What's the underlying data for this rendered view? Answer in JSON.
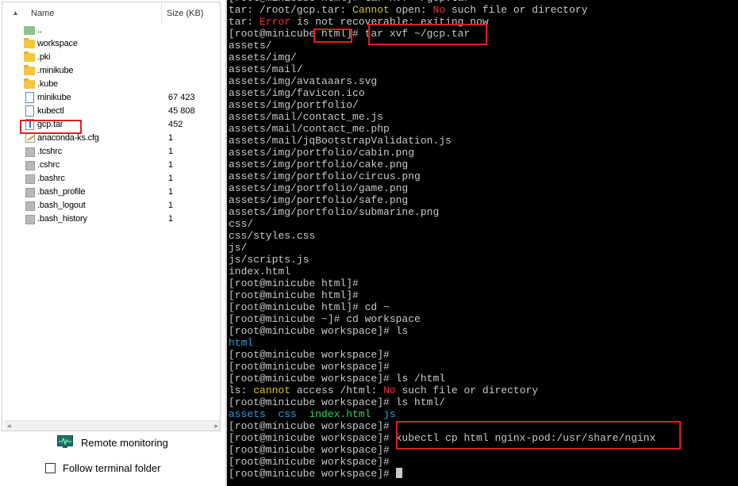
{
  "file_panel": {
    "headers": {
      "sort_arrow": "▲",
      "name": "Name",
      "size": "Size (KB)"
    },
    "files": [
      {
        "name": "..",
        "size": "",
        "icon": "up-folder-icon"
      },
      {
        "name": "workspace",
        "size": "",
        "icon": "folder-icon"
      },
      {
        "name": ".pki",
        "size": "",
        "icon": "folder-icon"
      },
      {
        "name": ".minikube",
        "size": "",
        "icon": "folder-icon"
      },
      {
        "name": ".kube",
        "size": "",
        "icon": "folder-icon"
      },
      {
        "name": "minikube",
        "size": "67 423",
        "icon": "file-icon"
      },
      {
        "name": "kubectl",
        "size": "45 808",
        "icon": "file-icon"
      },
      {
        "name": "gcp.tar",
        "size": "452",
        "icon": "archive-icon"
      },
      {
        "name": "anaconda-ks.cfg",
        "size": "1",
        "icon": "config-file-icon"
      },
      {
        "name": ".tcshrc",
        "size": "1",
        "icon": "hidden-file-icon"
      },
      {
        "name": ".cshrc",
        "size": "1",
        "icon": "hidden-file-icon"
      },
      {
        "name": ".bashrc",
        "size": "1",
        "icon": "hidden-file-icon"
      },
      {
        "name": ".bash_profile",
        "size": "1",
        "icon": "hidden-file-icon"
      },
      {
        "name": ".bash_logout",
        "size": "1",
        "icon": "hidden-file-icon"
      },
      {
        "name": ".bash_history",
        "size": "1",
        "icon": "hidden-file-icon"
      }
    ],
    "scroll_left": "◂",
    "scroll_right": "▸"
  },
  "remote_monitoring": {
    "label": "Remote monitoring",
    "icon": "monitor-icon"
  },
  "follow_terminal": {
    "label": "Follow terminal folder",
    "checked": false
  },
  "terminal": {
    "lines": [
      [
        {
          "t": "[root@minicube html]# tar xvf ~/gcp.tar"
        }
      ],
      [
        {
          "t": "tar: /root/gcp.tar: "
        },
        {
          "t": "Cannot",
          "c": "yellow"
        },
        {
          "t": " open: "
        },
        {
          "t": "No",
          "c": "red"
        },
        {
          "t": " such file or directory"
        }
      ],
      [
        {
          "t": "tar: "
        },
        {
          "t": "Error",
          "c": "red"
        },
        {
          "t": " is not recoverable: exiting now"
        }
      ],
      [
        {
          "t": "[root@minicube html]# tar xvf ~/gcp.tar"
        }
      ],
      [
        {
          "t": "assets/"
        }
      ],
      [
        {
          "t": "assets/img/"
        }
      ],
      [
        {
          "t": "assets/mail/"
        }
      ],
      [
        {
          "t": "assets/img/avataaars.svg"
        }
      ],
      [
        {
          "t": "assets/img/favicon.ico"
        }
      ],
      [
        {
          "t": "assets/img/portfolio/"
        }
      ],
      [
        {
          "t": "assets/mail/contact_me.js"
        }
      ],
      [
        {
          "t": "assets/mail/contact_me.php"
        }
      ],
      [
        {
          "t": "assets/mail/jqBootstrapValidation.js"
        }
      ],
      [
        {
          "t": "assets/img/portfolio/cabin.png"
        }
      ],
      [
        {
          "t": "assets/img/portfolio/cake.png"
        }
      ],
      [
        {
          "t": "assets/img/portfolio/circus.png"
        }
      ],
      [
        {
          "t": "assets/img/portfolio/game.png"
        }
      ],
      [
        {
          "t": "assets/img/portfolio/safe.png"
        }
      ],
      [
        {
          "t": "assets/img/portfolio/submarine.png"
        }
      ],
      [
        {
          "t": "css/"
        }
      ],
      [
        {
          "t": "css/styles.css"
        }
      ],
      [
        {
          "t": "js/"
        }
      ],
      [
        {
          "t": "js/scripts.js"
        }
      ],
      [
        {
          "t": "index.html"
        }
      ],
      [
        {
          "t": "[root@minicube html]#"
        }
      ],
      [
        {
          "t": "[root@minicube html]#"
        }
      ],
      [
        {
          "t": "[root@minicube html]# cd ~"
        }
      ],
      [
        {
          "t": "[root@minicube ~]# cd workspace"
        }
      ],
      [
        {
          "t": "[root@minicube workspace]# ls"
        }
      ],
      [
        {
          "t": "html",
          "c": "blue"
        }
      ],
      [
        {
          "t": "[root@minicube workspace]#"
        }
      ],
      [
        {
          "t": "[root@minicube workspace]#"
        }
      ],
      [
        {
          "t": "[root@minicube workspace]# ls /html"
        }
      ],
      [
        {
          "t": "ls: "
        },
        {
          "t": "cannot",
          "c": "yellow"
        },
        {
          "t": " access /html: "
        },
        {
          "t": "No",
          "c": "red"
        },
        {
          "t": " such file or directory"
        }
      ],
      [
        {
          "t": "[root@minicube workspace]# ls html/"
        }
      ],
      [
        {
          "t": "assets",
          "c": "blue"
        },
        {
          "t": "  "
        },
        {
          "t": "css",
          "c": "blue"
        },
        {
          "t": "  "
        },
        {
          "t": "index.html",
          "c": "green"
        },
        {
          "t": "  "
        },
        {
          "t": "js",
          "c": "blue"
        }
      ],
      [
        {
          "t": "[root@minicube workspace]#"
        }
      ],
      [
        {
          "t": "[root@minicube workspace]# kubectl cp html nginx-pod:/usr/share/nginx"
        }
      ],
      [
        {
          "t": "[root@minicube workspace]#"
        }
      ],
      [
        {
          "t": "[root@minicube workspace]#"
        }
      ],
      [
        {
          "t": "[root@minicube workspace]# "
        }
      ]
    ]
  }
}
